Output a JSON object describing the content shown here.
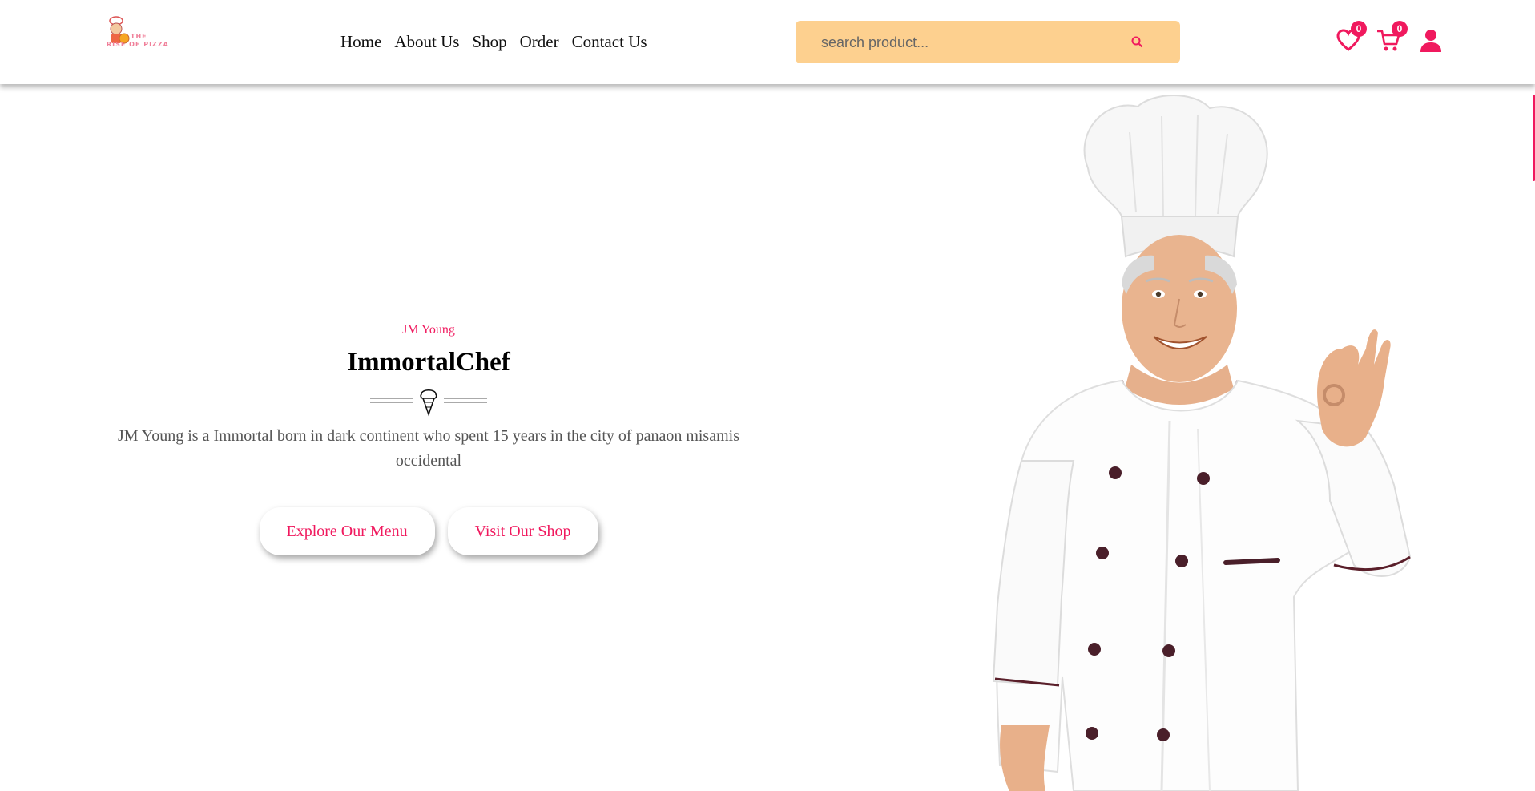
{
  "header": {
    "logo": {
      "line1": "THE",
      "line2": "RISE OF PIZZA"
    },
    "nav": [
      "Home",
      "About Us",
      "Shop",
      "Order",
      "Contact Us"
    ],
    "search": {
      "placeholder": "search product...",
      "value": ""
    },
    "wishlist_count": "0",
    "cart_count": "0"
  },
  "hero": {
    "subtitle": "JM Young",
    "title": "ImmortalChef",
    "description": "JM Young is a Immortal born in dark continent who spent 15 years in the city of panaon misamis occidental",
    "buttons": [
      "Explore Our Menu",
      "Visit Our Shop"
    ]
  },
  "colors": {
    "accent": "#f0195e",
    "search_bg": "#fdd08f",
    "text": "#111111"
  },
  "icons": [
    "search-icon",
    "heart-icon",
    "cart-icon",
    "user-icon",
    "ice-cream-icon"
  ]
}
